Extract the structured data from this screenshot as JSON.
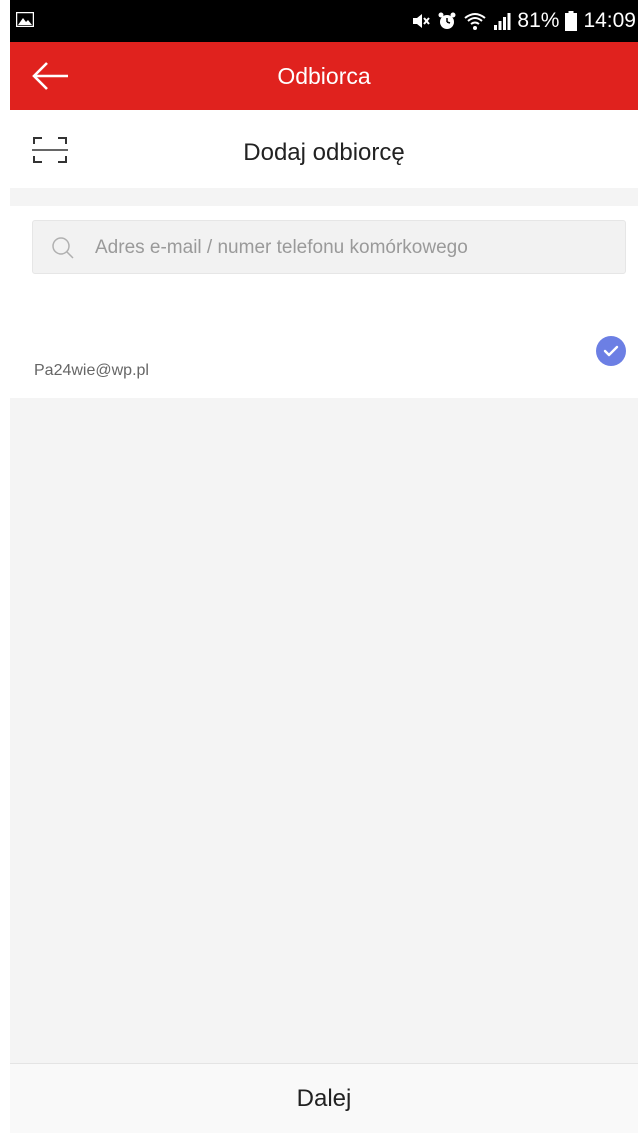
{
  "status_bar": {
    "battery": "81%",
    "time": "14:09"
  },
  "app_bar": {
    "title": "Odbiorca"
  },
  "add_recipient": {
    "heading": "Dodaj odbiorcę"
  },
  "search": {
    "placeholder": "Adres e-mail / numer telefonu komórkowego",
    "value": ""
  },
  "recipients": [
    {
      "email": "Pa24wie@wp.pl",
      "selected": true
    }
  ],
  "footer": {
    "next_label": "Dalej"
  },
  "colors": {
    "app_bar": "#e0221e",
    "check_badge": "#6c7fe4",
    "background": "#f4f4f4"
  },
  "icons": {
    "back": "arrow-left-icon",
    "scan": "scan-frame-icon",
    "search": "search-icon",
    "selected": "check-circle-icon"
  }
}
